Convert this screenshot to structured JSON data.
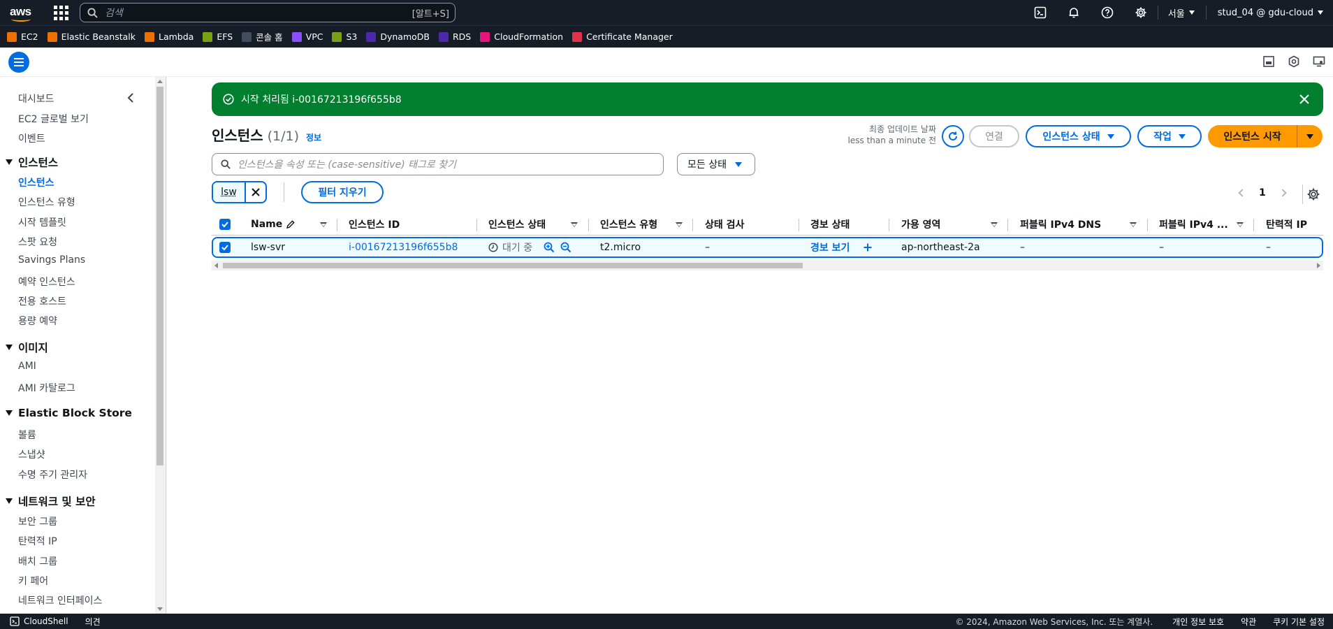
{
  "topbar": {
    "search_placeholder": "검색",
    "search_shortcut": "[알트+S]",
    "region": "서울",
    "account": "stud_04 @ gdu-cloud"
  },
  "favorites": [
    {
      "label": "EC2",
      "color": "#ed7100",
      "icon": "ec2-icon"
    },
    {
      "label": "Elastic Beanstalk",
      "color": "#ed7100",
      "icon": "beanstalk-icon"
    },
    {
      "label": "Lambda",
      "color": "#ed7100",
      "icon": "lambda-icon"
    },
    {
      "label": "EFS",
      "color": "#7aa116",
      "icon": "efs-icon"
    },
    {
      "label": "콘솔 홈",
      "color": "#414d5c",
      "icon": "console-home-icon"
    },
    {
      "label": "VPC",
      "color": "#8c4fff",
      "icon": "vpc-icon"
    },
    {
      "label": "S3",
      "color": "#7aa116",
      "icon": "s3-icon"
    },
    {
      "label": "DynamoDB",
      "color": "#4d27aa",
      "icon": "dynamodb-icon"
    },
    {
      "label": "RDS",
      "color": "#4d27aa",
      "icon": "rds-icon"
    },
    {
      "label": "CloudFormation",
      "color": "#e7157b",
      "icon": "cloudformation-icon"
    },
    {
      "label": "Certificate Manager",
      "color": "#dd344c",
      "icon": "certificate-manager-icon"
    }
  ],
  "sidenav": {
    "top_links": [
      "대시보드",
      "EC2 글로벌 보기",
      "이벤트"
    ],
    "sections": [
      {
        "title": "인스턴스",
        "items": [
          "인스턴스",
          "인스턴스 유형",
          "시작 템플릿",
          "스팟 요청",
          "Savings Plans",
          "예약 인스턴스",
          "전용 호스트",
          "용량 예약"
        ]
      },
      {
        "title": "이미지",
        "items": [
          "AMI",
          "AMI 카탈로그"
        ]
      },
      {
        "title": "Elastic Block Store",
        "items": [
          "볼륨",
          "스냅샷",
          "수명 주기 관리자"
        ]
      },
      {
        "title": "네트워크 및 보안",
        "items": [
          "보안 그룹",
          "탄력적 IP",
          "배치 그룹",
          "키 페어",
          "네트워크 인터페이스"
        ]
      }
    ],
    "active": "인스턴스"
  },
  "flash": {
    "message": "시작 처리됨 i-00167213196f655b8",
    "color": "#00802f"
  },
  "page": {
    "title": "인스턴스",
    "count": "(1/1)",
    "info": "정보",
    "last_update_label": "최종 업데이트 날짜",
    "last_update_value": "less than a minute 전",
    "connect": "연결",
    "instance_state": "인스턴스 상태",
    "actions": "작업",
    "launch": "인스턴스 시작",
    "filter_placeholder": "인스턴스을 속성 또는 (case-sensitive) 태그로 찾기",
    "state_filter": "모든 상태",
    "token": "lsw",
    "clear_filters": "필터 지우기",
    "page_number": "1"
  },
  "table": {
    "columns": [
      "Name",
      "인스턴스 ID",
      "인스턴스 상태",
      "인스턴스 유형",
      "상태 검사",
      "경보 상태",
      "가용 영역",
      "퍼블릭 IPv4 DNS",
      "퍼블릭 IPv4 ...",
      "탄력적 IP"
    ],
    "rows": [
      {
        "name": "lsw-svr",
        "instance_id": "i-00167213196f655b8",
        "state": "대기 중",
        "type": "t2.micro",
        "status_check": "–",
        "alarm": "경보 보기",
        "az": "ap-northeast-2a",
        "public_dns": "–",
        "public_ip": "–",
        "eip": "–"
      }
    ]
  },
  "footer": {
    "cloudshell": "CloudShell",
    "feedback": "의견",
    "copyright": "© 2024, Amazon Web Services, Inc. 또는 계열사.",
    "privacy": "개인 정보 보호",
    "terms": "약관",
    "cookies": "쿠키 기본 설정"
  },
  "colors": {
    "accent": "#006ce0",
    "launch": "#ff9900",
    "nav_bg": "#161d26"
  }
}
